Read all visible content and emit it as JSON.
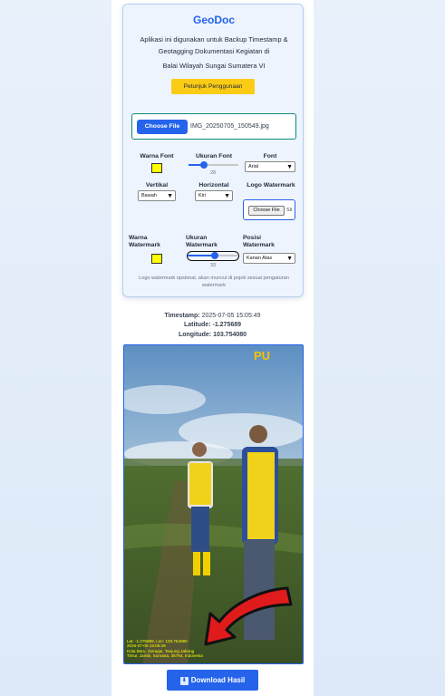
{
  "app": {
    "title": "GeoDoc",
    "description": "Aplikasi ini digunakan untuk Backup Timestamp & Geotagging Dokumentasi Kegiatan di",
    "org": "Balai Wilayah Sungai Sumatera VI",
    "guide_button": "Petunjuk Penggunaan"
  },
  "upload": {
    "choose_label": "Choose File",
    "file_name": "IMG_20250705_150549.jpg"
  },
  "settings": {
    "font_color_label": "Warna Font",
    "font_color": "#ffff00",
    "font_size_label": "Ukuran Font",
    "font_size_value": "28",
    "font_size_fraction": 0.27,
    "font_label": "Font",
    "font_value": "Arial",
    "vertical_label": "Vertikal",
    "vertical_value": "Bawah",
    "horizontal_label": "Horizontal",
    "horizontal_value": "Kiri",
    "logo_label": "Logo Watermark",
    "logo_choose_label": "Choose File",
    "logo_file_text": "Sli",
    "wm_color_label_1": "Warna",
    "wm_color_label_2": "Watermark",
    "wm_color": "#ffff00",
    "wm_size_label_1": "Ukuran",
    "wm_size_label_2": "Watermark",
    "wm_size_value": "33",
    "wm_size_fraction": 0.55,
    "wm_pos_label_1": "Posisi",
    "wm_pos_label_2": "Watermark",
    "wm_pos_value": "Kanan Atas",
    "note": "Logo watermark opsional, akan muncul di pojok sesuai pengaturan watermark"
  },
  "meta": {
    "timestamp_label": "Timestamp:",
    "timestamp_value": "2025-07-05 15:05:49",
    "latitude_label": "Latitude:",
    "latitude_value": "-1.275689",
    "longitude_label": "Longitude:",
    "longitude_value": "103.754080"
  },
  "photo": {
    "logo_text": "PU",
    "overlay_line1": "Lat: -1.275689, Lon: 103.754080",
    "overlay_line2": "2025-07-05 15:05:49",
    "overlay_line3": "Kota Baru, Geragai, Tanjung Jabung",
    "overlay_line4": "Timur, Jambi, Sumatra, 36764, Indonesia"
  },
  "download_button": "Download Hasil",
  "colors": {
    "accent": "#2563eb",
    "guide_button": "#facc15",
    "overlay_text": "#ffff00",
    "arrow": "#e01b1b"
  }
}
